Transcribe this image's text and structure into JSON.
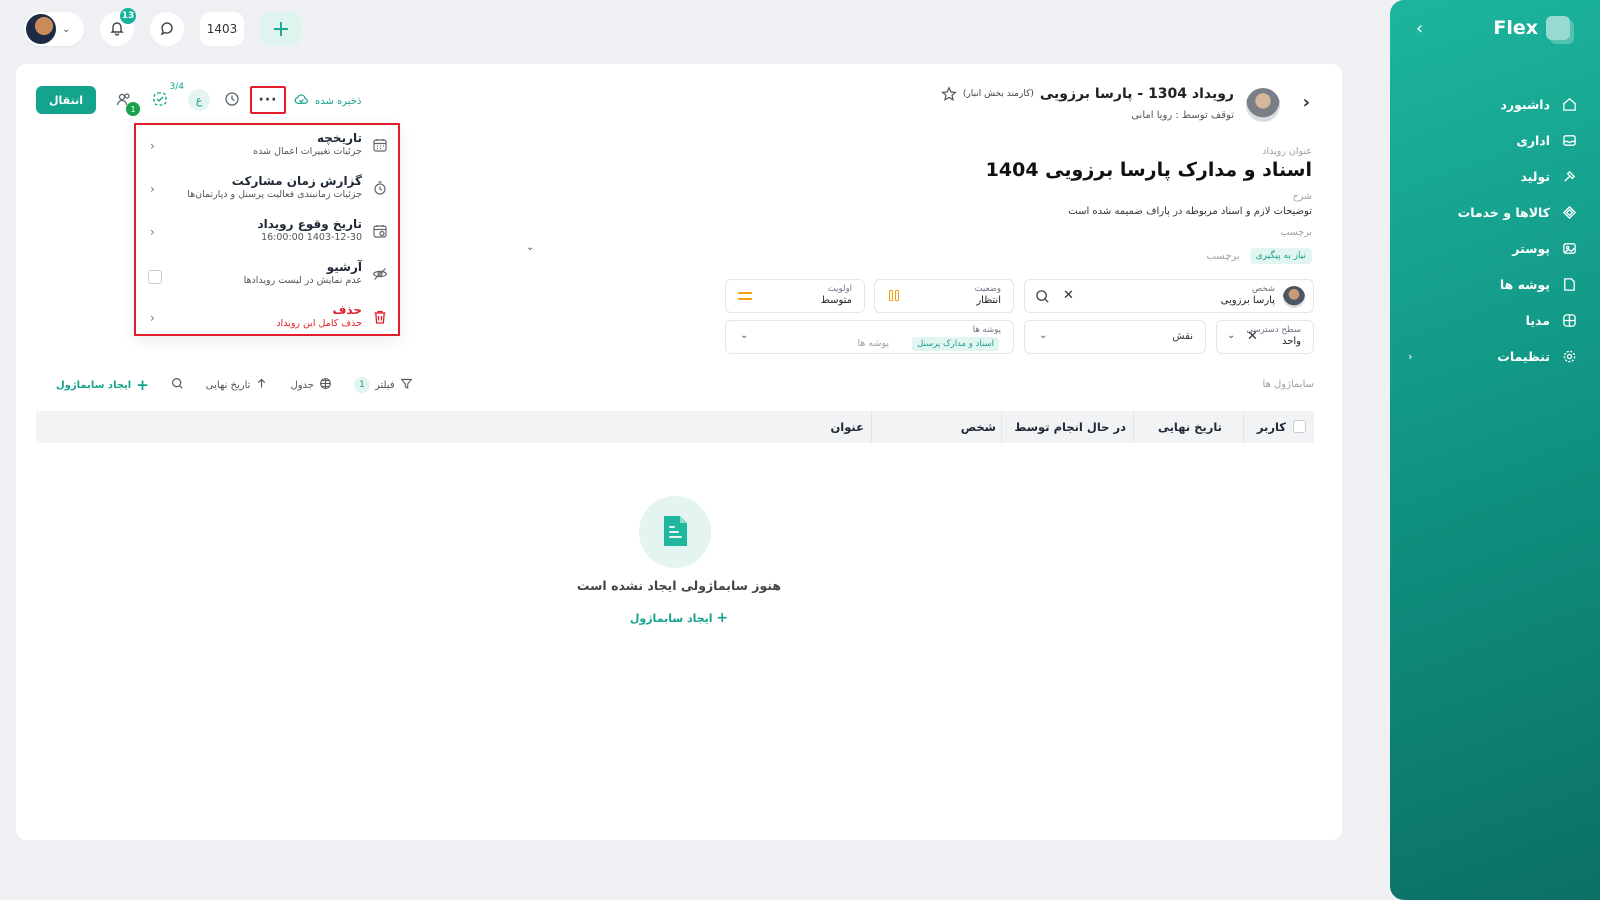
{
  "sidebar": {
    "brand": "Flex",
    "items": [
      {
        "label": "داشبورد",
        "icon": "home-icon"
      },
      {
        "label": "اداری",
        "icon": "inbox-icon"
      },
      {
        "label": "تولید",
        "icon": "hammer-icon"
      },
      {
        "label": "کالاها و خدمات",
        "icon": "box-icon"
      },
      {
        "label": "پوستر",
        "icon": "image-icon"
      },
      {
        "label": "پوشه ها",
        "icon": "folder-icon"
      },
      {
        "label": "مدیا",
        "icon": "globe-icon"
      },
      {
        "label": "تنظیمات",
        "icon": "gear-icon"
      }
    ]
  },
  "topbar": {
    "notification_count": "13",
    "year": "1403"
  },
  "event": {
    "title": "رویداد 1304 - پارسا برزویی",
    "role": "(کارمند بخش انبار)",
    "subtitle": "توقف توسط : رویا امانی",
    "title_label": "عنوان رویداد",
    "doc_title": "اسناد و مدارک پارسا برزویی 1404",
    "desc_label": "شرح",
    "desc": "توضیحات لازم و اسناد مربوطه در پاراف ضمیمه شده است",
    "tag_label": "برچسب",
    "tag_chip": "نیاز به پیگیری",
    "tag_placeholder": "برچسب"
  },
  "toolbar": {
    "transfer": "انتقال",
    "people_badge": "1",
    "check_ratio": "3/4",
    "ain": "ع",
    "saved": "ذخیره شده",
    "more": "···"
  },
  "menu": [
    {
      "title": "تاریخچه",
      "sub": "جزئیات تغییرات اعمال شده"
    },
    {
      "title": "گزارش زمان مشارکت",
      "sub": "جزئیات زمانبندی فعالیت پرسنل و دپارتمان‌ها"
    },
    {
      "title": "تاریخ وقوع رویداد",
      "sub": "1403-12-30 16:00:00"
    },
    {
      "title": "آرشیو",
      "sub": "عدم نمایش در لیست رویدادها"
    },
    {
      "title": "حذف",
      "sub": "حذف کامل این رویداد"
    }
  ],
  "fields": {
    "person_label": "شخص",
    "person_value": "پارسا برزویی",
    "status_label": "وضعیت",
    "status_value": "انتظار",
    "priority_label": "اولویت",
    "priority_value": "متوسط",
    "access_label": "سطح دسترسی",
    "access_value": "واحد",
    "role_placeholder": "نقش",
    "folders_label": "پوشه ها",
    "folders_chip": "اسناد و مدارک پرسنل",
    "folders_placeholder": "پوشه ها"
  },
  "subtasks": {
    "label": "سابماژول ها",
    "create": "ایجاد سابماژول",
    "due_date": "تاریخ نهایی",
    "table": "جدول",
    "filter": "فیلتر",
    "filter_count": "1"
  },
  "table": {
    "columns": [
      "کاربر",
      "تاریخ نهایی",
      "در حال انجام توسط",
      "شخص",
      "عنوان"
    ]
  },
  "empty": {
    "text": "هنوز سابماژولی ایجاد نشده است",
    "create": "ایجاد سابماژول"
  },
  "colors": {
    "accent": "#14a38c",
    "danger": "#e11d2a",
    "priority": "#f59e0b"
  }
}
